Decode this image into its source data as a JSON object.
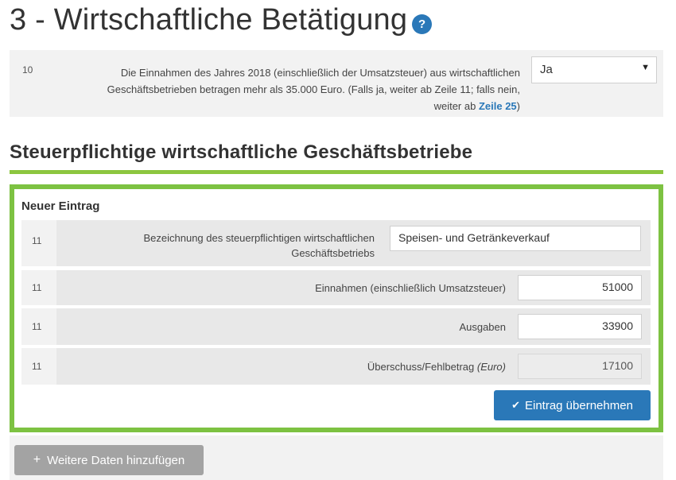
{
  "page": {
    "title_prefix": "3 - Wirtschaftliche Betätigung",
    "help_icon_glyph": "?"
  },
  "question10": {
    "number": "10",
    "text_line1": "Die Einnahmen des Jahres 2018 (einschließlich der Umsatzsteuer) aus wirtschaftlichen",
    "text_line2": "Geschäftsbetrieben betragen mehr als 35.000 Euro. (Falls ja, weiter ab Zeile 11; falls nein,",
    "text_line3_prefix": "weiter ab ",
    "text_link": "Zeile 25",
    "text_line3_suffix": ")",
    "select_value": "Ja",
    "select_arrow": "▼"
  },
  "section": {
    "title": "Steuerpflichtige wirtschaftliche Geschäftsbetriebe"
  },
  "entry": {
    "heading": "Neuer Eintrag",
    "rows": [
      {
        "number": "11",
        "label_line1": "Bezeichnung des steuerpflichtigen wirtschaftlichen",
        "label_line2": "Geschäftsbetriebs",
        "value": "Speisen- und Getränkeverkauf"
      },
      {
        "number": "11",
        "label": "Einnahmen (einschließlich Umsatzsteuer)",
        "value": "51000"
      },
      {
        "number": "11",
        "label": "Ausgaben",
        "value": "33900"
      },
      {
        "number": "11",
        "label": "Überschuss/Fehlbetrag",
        "label_unit": "(Euro)",
        "value": "17100"
      }
    ],
    "submit_label": "Eintrag übernehmen",
    "submit_icon": "✔"
  },
  "footer": {
    "add_more_label": "Weitere Daten hinzufügen",
    "add_more_icon": "+"
  },
  "colors": {
    "accent_green": "#7dc242",
    "primary_blue": "#2a78b8",
    "secondary_gray": "#a3a3a3"
  }
}
